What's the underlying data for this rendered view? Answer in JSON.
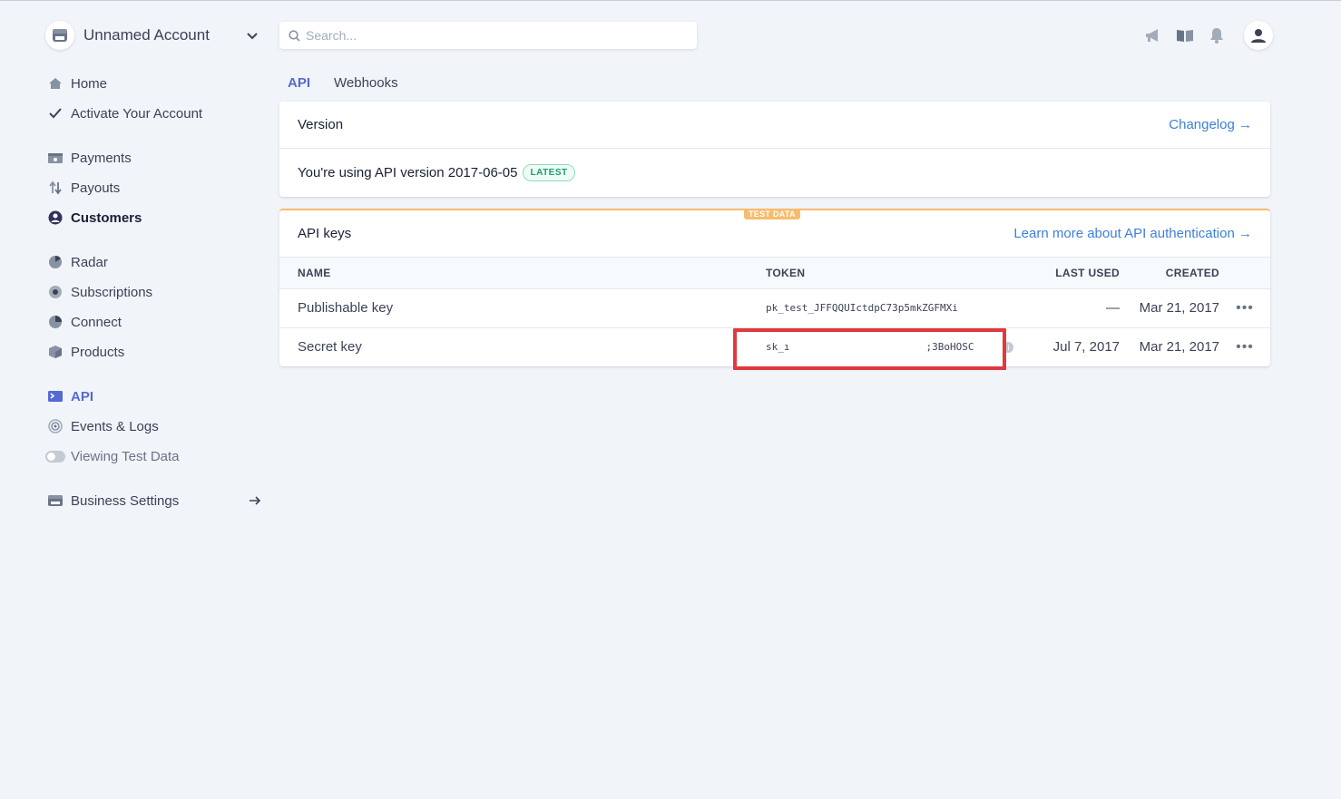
{
  "account": {
    "name": "Unnamed Account"
  },
  "search": {
    "placeholder": "Search..."
  },
  "sidebar": {
    "items": [
      {
        "label": "Home"
      },
      {
        "label": "Activate Your Account"
      },
      {
        "label": "Payments"
      },
      {
        "label": "Payouts"
      },
      {
        "label": "Customers"
      },
      {
        "label": "Radar"
      },
      {
        "label": "Subscriptions"
      },
      {
        "label": "Connect"
      },
      {
        "label": "Products"
      },
      {
        "label": "API"
      },
      {
        "label": "Events & Logs"
      },
      {
        "label": "Viewing Test Data"
      },
      {
        "label": "Business Settings"
      }
    ]
  },
  "tabs": [
    {
      "label": "API"
    },
    {
      "label": "Webhooks"
    }
  ],
  "version_card": {
    "title": "Version",
    "link": "Changelog →",
    "text": "You're using API version 2017-06-05",
    "badge": "LATEST"
  },
  "keys_card": {
    "badge": "TEST DATA",
    "title": "API keys",
    "link": "Learn more about API authentication →",
    "columns": {
      "name": "NAME",
      "token": "TOKEN",
      "last_used": "LAST USED",
      "created": "CREATED"
    },
    "rows": [
      {
        "name": "Publishable key",
        "token": "pk_test_JFFQQUIctdpC73p5mkZGFMXi",
        "last_used": "—",
        "created": "Mar 21, 2017"
      },
      {
        "name": "Secret key",
        "token_start": "sk_ı",
        "token_end": ";3BoHOSC",
        "last_used": "Jul 7, 2017",
        "created": "Mar 21, 2017"
      }
    ],
    "more": "•••"
  },
  "colors": {
    "accent": "#5469d4",
    "link": "#3d7fd8",
    "highlight": "#e0393e",
    "test_badge": "#f9bc6b"
  }
}
